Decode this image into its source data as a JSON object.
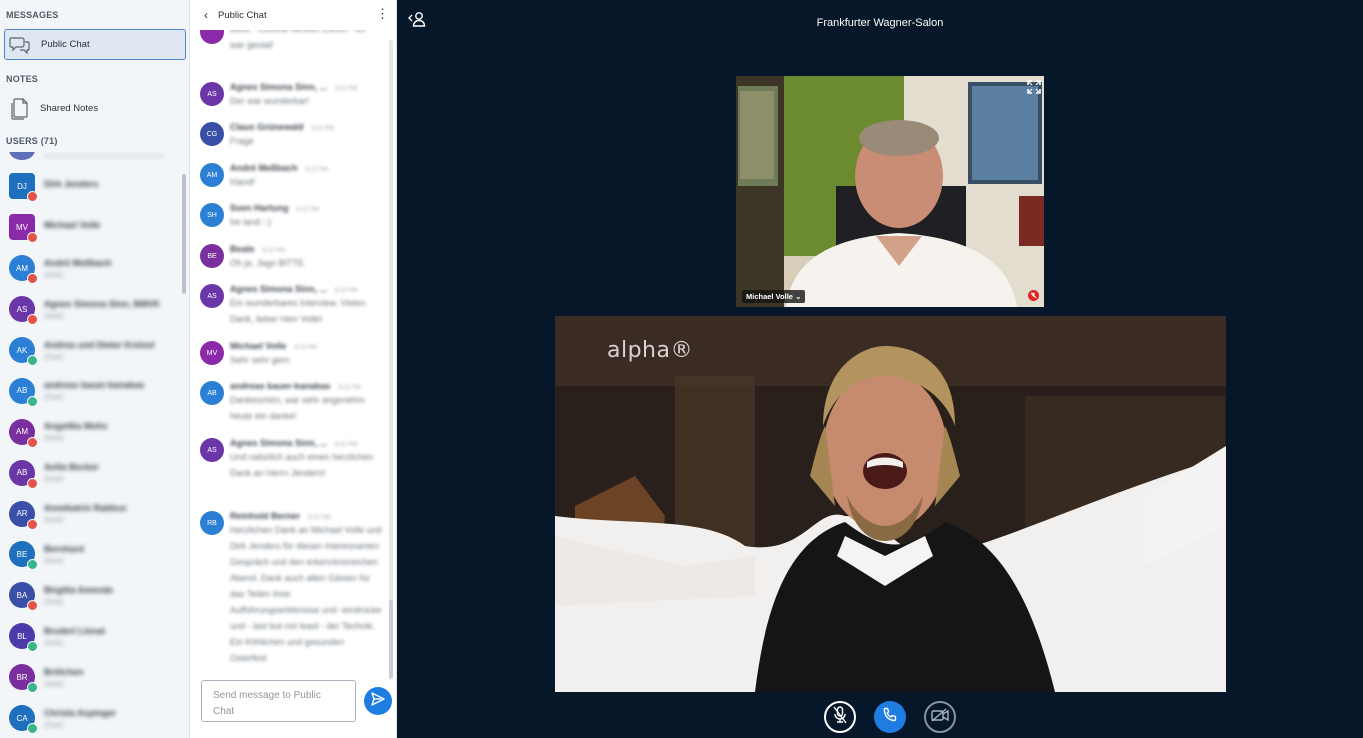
{
  "nav": {
    "messages_title": "MESSAGES",
    "public_chat_label": "Public Chat",
    "notes_title": "NOTES",
    "shared_notes_label": "Shared Notes",
    "users_title": "USERS (71)"
  },
  "users": [
    {
      "name": "Dirk Jenders",
      "initials": "DJ",
      "color": "#1e6fbd",
      "square": true,
      "status": "#e5524a",
      "sub": ""
    },
    {
      "name": "Michael Volle",
      "initials": "MV",
      "color": "#8a2aa8",
      "square": true,
      "status": "#e5524a",
      "sub": ""
    },
    {
      "name": "André Meßbach",
      "initials": "AM",
      "color": "#2b7fd4",
      "square": false,
      "status": "#e5524a",
      "sub": "(Gast)"
    },
    {
      "name": "Agnes Simona Sinn, BMVK",
      "initials": "AS",
      "color": "#6b36a8",
      "square": false,
      "status": "#e5524a",
      "sub": "(Gast)"
    },
    {
      "name": "Andrea und Dieter Kretzel",
      "initials": "AK",
      "color": "#2b7fd4",
      "square": false,
      "status": "#3ab58a",
      "sub": "(Gast)"
    },
    {
      "name": "andreas bauer-kanabas",
      "initials": "AB",
      "color": "#2b7fd4",
      "square": false,
      "status": "#3ab58a",
      "sub": "(Gast)"
    },
    {
      "name": "Angelika Mohs",
      "initials": "AM",
      "color": "#7a2f9f",
      "square": false,
      "status": "#e5524a",
      "sub": "(Gast)"
    },
    {
      "name": "Anita Becker",
      "initials": "AB",
      "color": "#6b36a8",
      "square": false,
      "status": "#e5524a",
      "sub": "(Gast)"
    },
    {
      "name": "Annekatrin Rabbus",
      "initials": "AR",
      "color": "#3a4fa8",
      "square": false,
      "status": "#e5524a",
      "sub": "(Gast)"
    },
    {
      "name": "Bernhard",
      "initials": "BE",
      "color": "#1e6fbd",
      "square": false,
      "status": "#3ab58a",
      "sub": "(Gast)"
    },
    {
      "name": "Birgitta Amende",
      "initials": "BA",
      "color": "#3a4fa8",
      "square": false,
      "status": "#e5524a",
      "sub": "(Gast)"
    },
    {
      "name": "Bruderl Lienat",
      "initials": "BL",
      "color": "#4b3aa8",
      "square": false,
      "status": "#3ab58a",
      "sub": "(Gast)"
    },
    {
      "name": "Brötchen",
      "initials": "BR",
      "color": "#7a2f9f",
      "square": false,
      "status": "#3ab58a",
      "sub": "(Gast)"
    },
    {
      "name": "Christa Aspinger",
      "initials": "CA",
      "color": "#1e6fbd",
      "square": false,
      "status": "#3ab58a",
      "sub": "(Gast)"
    }
  ],
  "chat": {
    "title": "Public Chat",
    "input_placeholder": "Send message to Public Chat",
    "messages": [
      {
        "author": "",
        "time": "",
        "initials": "",
        "color": "#8a2aa8",
        "text": "Bock · Corona Version Zürich · es war genial!"
      },
      {
        "author": "Agnes Simona Sinn, ...",
        "time": "8:22 PM",
        "initials": "AS",
        "color": "#6b36a8",
        "text": "Der war wunderbar!"
      },
      {
        "author": "Claus Grünewald",
        "time": "8:22 PM",
        "initials": "CG",
        "color": "#3a4fa8",
        "text": "Frage"
      },
      {
        "author": "André Meßbach",
        "time": "8:22 PM",
        "initials": "AM",
        "color": "#2b7fd4",
        "text": "Irland!"
      },
      {
        "author": "Sven Hartung",
        "time": "8:22 PM",
        "initials": "SH",
        "color": "#2b7fd4",
        "text": "Ire land :-)"
      },
      {
        "author": "Beate",
        "time": "8:22 PM",
        "initials": "BE",
        "color": "#7a2f9f",
        "text": "Oh ja, Jago BITTE"
      },
      {
        "author": "Agnes Simona Sinn, ...",
        "time": "8:22 PM",
        "initials": "AS",
        "color": "#6b36a8",
        "text": "Ein wunderbares Interview. Vielen Dank, lieber Herr Volle!"
      },
      {
        "author": "Michael Volle",
        "time": "8:22 PM",
        "initials": "MV",
        "color": "#8a2aa8",
        "text": "Sehr sehr gern"
      },
      {
        "author": "andreas bauer-kanabas",
        "time": "8:22 PM",
        "initials": "AB",
        "color": "#2b7fd4",
        "text": "Dankeschön, war sehr angenehm heute ein danke!"
      },
      {
        "author": "Agnes Simona Sinn, ...",
        "time": "8:22 PM",
        "initials": "AS",
        "color": "#6b36a8",
        "text": "Und natürlich auch einen herzlichen Dank an Herrn Jenders!"
      },
      {
        "author": "Reinhold Berner",
        "time": "8:22 PM",
        "initials": "RB",
        "color": "#2b7fd4",
        "text": "Herzlichen Dank an Michael Volle und Dirk Jenders für diesen interessanten Gespräch und den erkenntnisreichen Abend. Dank auch allen Gästen für das Teilen ihrer Aufführungserlebnisse und -eindrücke und - last but not least - der Technik. Ein fröhlichen und gesunden Osterfest"
      }
    ]
  },
  "stage": {
    "title": "Frankfurter Wagner-Salon",
    "presenter_name": "Michael Volle",
    "channel_logo": "alpha®"
  },
  "icons": {
    "chat": "chat-bubbles-icon",
    "notes": "document-icon",
    "send": "send-icon",
    "mute": "microphone-muted-icon",
    "audio": "phone-icon",
    "video": "camera-off-icon",
    "fullscreen": "fullscreen-icon",
    "users_toggle": "user-list-toggle-icon"
  },
  "colors": {
    "accent": "#1f7ce0",
    "stage_bg": "#06172a",
    "muted": "#df2721"
  }
}
